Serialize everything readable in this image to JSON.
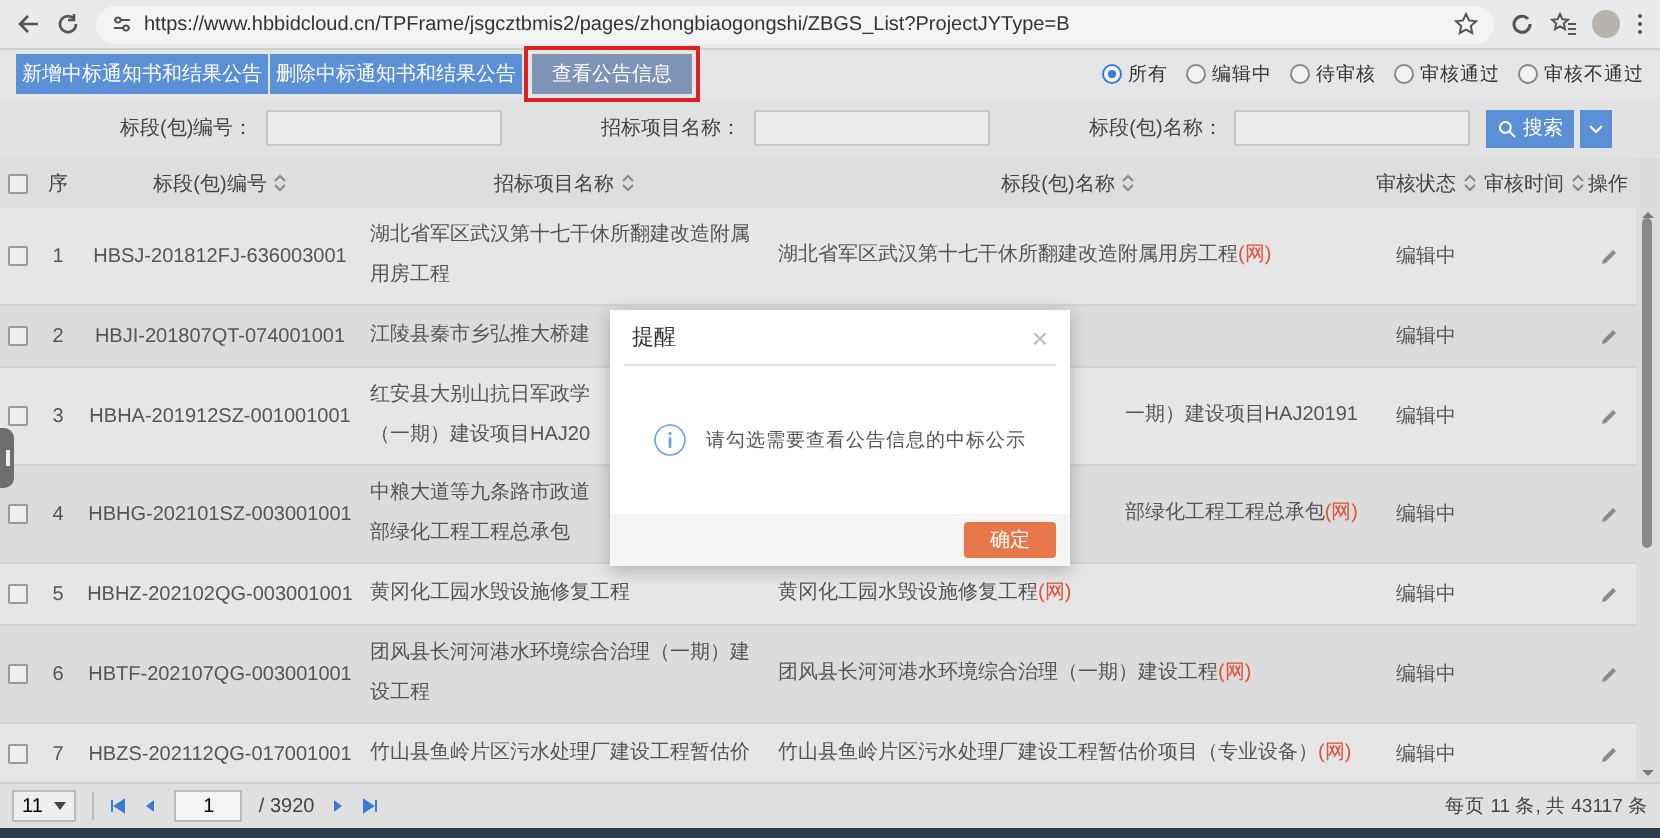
{
  "browser": {
    "url": "https://www.hbbidcloud.cn/TPFrame/jsgcztbmis2/pages/zhongbiaogongshi/ZBGS_List?ProjectJYType=B"
  },
  "toolbar": {
    "buttons": [
      {
        "label": "新增中标通知书和结果公告",
        "highlighted": false
      },
      {
        "label": "删除中标通知书和结果公告",
        "highlighted": false
      },
      {
        "label": "查看公告信息",
        "highlighted": true
      }
    ],
    "filters": [
      {
        "label": "所有",
        "selected": true
      },
      {
        "label": "编辑中",
        "selected": false
      },
      {
        "label": "待审核",
        "selected": false
      },
      {
        "label": "审核通过",
        "selected": false
      },
      {
        "label": "审核不通过",
        "selected": false
      }
    ]
  },
  "search": {
    "fields": [
      {
        "label": "标段(包)编号："
      },
      {
        "label": "招标项目名称："
      },
      {
        "label": "标段(包)名称："
      }
    ],
    "button": "搜索"
  },
  "table": {
    "all_checked": false,
    "columns": [
      {
        "label": "序",
        "sortable": false
      },
      {
        "label": "标段(包)编号",
        "sortable": true
      },
      {
        "label": "招标项目名称",
        "sortable": true
      },
      {
        "label": "标段(包)名称",
        "sortable": true
      },
      {
        "label": "审核状态",
        "sortable": true
      },
      {
        "label": "审核时间",
        "sortable": true
      },
      {
        "label": "操作",
        "sortable": false
      }
    ],
    "rows": [
      {
        "no": "1",
        "code": "HBSJ-201812FJ-636003001",
        "project": "湖北省军区武汉第十七干休所翻建改造附属用房工程",
        "package": {
          "text": "湖北省军区武汉第十七干休所翻建改造附属用房工程",
          "net": "(网)"
        },
        "status": "编辑中",
        "checked": false,
        "clipped": false
      },
      {
        "no": "2",
        "code": "HBJI-201807QT-074001001",
        "project": "江陵县秦市乡弘推大桥建",
        "status": "编辑中",
        "checked": false,
        "clipped": true
      },
      {
        "no": "3",
        "code": "HBHA-201912SZ-001001001",
        "project": "红安县大别山抗日军政学（一期）建设项目HAJ20",
        "package": {
          "text": "一期）建设项目HAJ20191"
        },
        "status": "编辑中",
        "checked": false,
        "clipped": true
      },
      {
        "no": "4",
        "code": "HBHG-202101SZ-003001001",
        "project": "中粮大道等九条路市政道部绿化工程工程总承包",
        "package": {
          "text": "部绿化工程工程总承包",
          "net": "(网)"
        },
        "status": "编辑中",
        "checked": false,
        "clipped": true
      },
      {
        "no": "5",
        "code": "HBHZ-202102QG-003001001",
        "project": "黄冈化工园水毁设施修复工程",
        "package": {
          "text": "黄冈化工园水毁设施修复工程",
          "net": "(网)"
        },
        "status": "编辑中",
        "checked": false,
        "clipped": false
      },
      {
        "no": "6",
        "code": "HBTF-202107QG-003001001",
        "project": "团风县长河河港水环境综合治理（一期）建设工程",
        "package": {
          "text": "团风县长河河港水环境综合治理（一期）建设工程",
          "net": "(网)"
        },
        "status": "编辑中",
        "checked": false,
        "clipped": false
      },
      {
        "no": "7",
        "code": "HBZS-202112QG-017001001",
        "project": "竹山县鱼岭片区污水处理厂建设工程暂估价",
        "package": {
          "text": "竹山县鱼岭片区污水处理厂建设工程暂估价项目（专业设备）",
          "net": "(网)"
        },
        "status": "编辑中",
        "checked": false,
        "clipped": false
      }
    ]
  },
  "pager": {
    "page_size": "11",
    "page": "1",
    "pages": "/ 3920",
    "summary": "每页 11 条, 共 43117 条"
  },
  "dialog": {
    "title": "提醒",
    "close": "×",
    "message": "请勾选需要查看公告信息的中标公示",
    "ok": "确定"
  }
}
